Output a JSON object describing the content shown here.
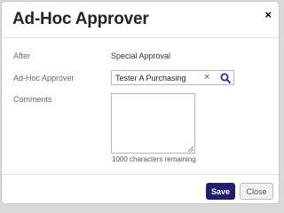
{
  "dialog": {
    "title": "Ad-Hoc Approver",
    "close_glyph": "×"
  },
  "form": {
    "after_label": "After",
    "after_value": "Special Approval",
    "approver_label": "Ad-Hoc Approver",
    "approver_value": "Tester A Purchasing",
    "clear_glyph": "×",
    "comments_label": "Comments",
    "comments_value": "",
    "remaining_text": "1000 characters remaining"
  },
  "footer": {
    "save_label": "Save",
    "close_label": "Close"
  },
  "colors": {
    "primary": "#1f1f6e",
    "search_icon": "#1f3a8a"
  },
  "icons": {
    "dialog_close": "close-icon",
    "field_clear": "clear-icon",
    "field_search": "search-icon"
  }
}
